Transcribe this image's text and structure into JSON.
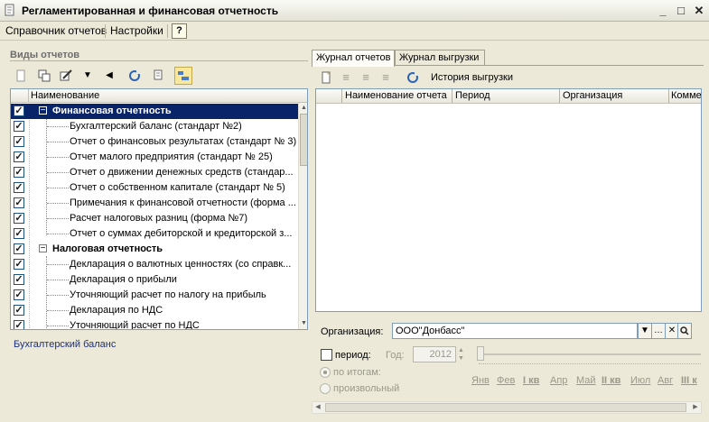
{
  "window": {
    "title": "Регламентированная и финансовая отчетность"
  },
  "menu": {
    "items": [
      "Справочник отчетов",
      "Настройки"
    ],
    "help": "?"
  },
  "left": {
    "section_title": "Виды отчетов",
    "column_header": "Наименование",
    "rows": [
      {
        "label": "Финансовая  отчетность",
        "group": true,
        "expanded": true,
        "checked": true
      },
      {
        "label": "Бухгалтерский баланс (стандарт №2)",
        "checked": true
      },
      {
        "label": "Отчет о финансовых результатах (стандарт № 3)",
        "checked": true
      },
      {
        "label": "Отчет малого предприятия (стандарт № 25)",
        "checked": true
      },
      {
        "label": "Отчет о движении денежных средств (стандар...",
        "checked": true
      },
      {
        "label": "Отчет о собственном капитале (стандарт № 5)",
        "checked": true
      },
      {
        "label": "Примечания к финансовой отчетности (форма ...",
        "checked": true
      },
      {
        "label": "Расчет налоговых разниц (форма №7)",
        "checked": true
      },
      {
        "label": "Отчет о суммах дебиторской и кредиторской з...",
        "checked": true
      },
      {
        "label": "Налоговая отчетность",
        "group": true,
        "expanded": true,
        "checked": true
      },
      {
        "label": "Декларация о валютных ценностях (со справк...",
        "checked": true
      },
      {
        "label": "Декларация о прибыли",
        "checked": true
      },
      {
        "label": "Уточняющий расчет по налогу на прибыль",
        "checked": true
      },
      {
        "label": "Декларация по НДС",
        "checked": true
      },
      {
        "label": "Уточняющий расчет по НДС",
        "checked": true
      }
    ],
    "footer_label": "Бухгалтерский баланс"
  },
  "right": {
    "tabs": [
      "Журнал отчетов",
      "Журнал выгрузки"
    ],
    "toolbar_label": "История выгрузки",
    "columns": [
      "Наименование отчета",
      "Период",
      "Организация",
      "Комме"
    ],
    "org_label": "Организация:",
    "org_value": "ООО\"Донбасс\"",
    "period_label": "период:",
    "year_label": "Год:",
    "year_value": "2012",
    "radio_totals": "по итогам:",
    "radio_custom": "произвольный",
    "months": [
      "Янв",
      "Фев",
      "I кв",
      "Апр",
      "Май",
      "II кв",
      "Июл",
      "Авг",
      "III к"
    ]
  },
  "colors": {
    "selection": "#0a246a",
    "accent": "#f7e89d"
  }
}
